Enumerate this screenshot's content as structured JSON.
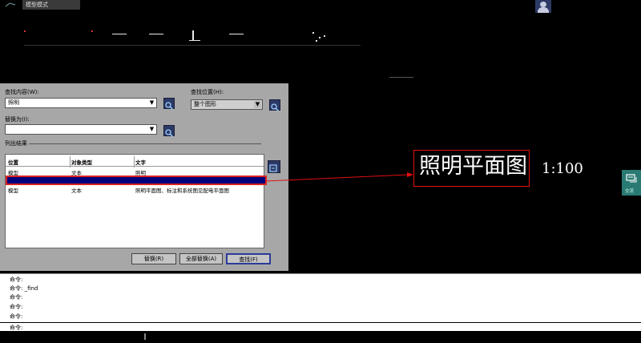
{
  "app": {
    "tab_label": "模型模式"
  },
  "dialog": {
    "find_content_label": "查找内容(W):",
    "find_content_value": "照明",
    "search_in_label": "查找位置(H):",
    "search_in_value": "整个图形",
    "replace_label": "替换为(I):",
    "replace_value": "",
    "results_label": "列出结果",
    "columns": [
      "位置",
      "对象类型",
      "文字"
    ],
    "rows": [
      {
        "location": "模型",
        "type": "文本",
        "text": "照明"
      },
      {
        "location": "",
        "type": "",
        "text": ""
      },
      {
        "location": "模型",
        "type": "文本",
        "text": "照明平面图、标注和系统图见配电平面图"
      }
    ],
    "buttons": {
      "replace": "替换(R)",
      "replace_all": "全部替换(A)",
      "find": "查找(F)"
    }
  },
  "canvas": {
    "title_text": "照明平面图",
    "scale_text": "1:100"
  },
  "side": {
    "chat_label": "交流"
  },
  "command": {
    "history": [
      "命令:",
      "命令: _find",
      "命令:",
      "命令:",
      "命令:"
    ],
    "prompt": "命令:"
  },
  "colors": {
    "highlight": "#00007a",
    "annotation_red": "#e01010",
    "dialog_bg": "#a7a7a7"
  }
}
